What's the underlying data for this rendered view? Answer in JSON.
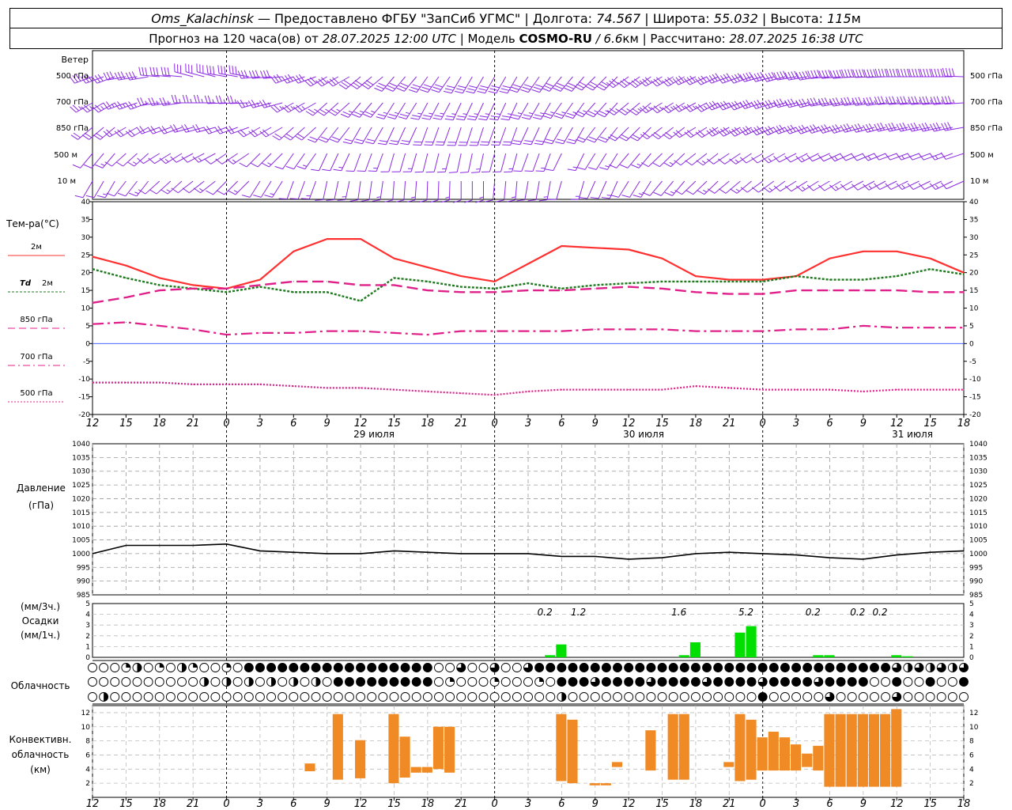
{
  "header": {
    "station": "Oms_Kalachinsk",
    "provider": "— Предоставлено ФГБУ \"ЗапСиб УГМС\"",
    "lon_label": "| Долгота:",
    "lon_value": "74.567",
    "lat_label": "| Широта:",
    "lat_value": "55.032",
    "alt_label": "| Высота:",
    "alt_value": "115",
    "alt_unit": "м",
    "forecast_label": "Прогноз на 120 часа(ов) от",
    "forecast_time": "28.07.2025 12:00 UTC",
    "model_label": "| Модель",
    "model_name": "COSMO-RU",
    "model_res": "/ 6.6",
    "model_res_unit": "км",
    "calc_label": "| Рассчитано:",
    "calc_time": "28.07.2025 16:38 UTC"
  },
  "wind_panel": {
    "title": "Ветер",
    "levels": [
      "500 гПа",
      "700 гПа",
      "850 гПа",
      "500 м",
      "10 м"
    ],
    "barb_color": "#8a2be2"
  },
  "temperature_panel": {
    "title": "Тем-ра(°С)",
    "legend": [
      {
        "label": "2м",
        "color": "#ff3030",
        "style": "solid"
      },
      {
        "label": "Td",
        "label2": "2м",
        "color": "#1f7a1f",
        "style": "dotted"
      },
      {
        "label": "850 гПа",
        "color": "#e0208a",
        "style": "dashed"
      },
      {
        "label": "700 гПа",
        "color": "#e0208a",
        "style": "dashdot"
      },
      {
        "label": "500 гПа",
        "color": "#e0208a",
        "style": "dotted"
      }
    ]
  },
  "time_axis": {
    "hour_labels": [
      "12",
      "15",
      "18",
      "21",
      "0",
      "3",
      "6",
      "9",
      "12",
      "15",
      "18",
      "21",
      "0",
      "3",
      "6",
      "9",
      "12",
      "15",
      "18",
      "21",
      "0",
      "3",
      "6",
      "9",
      "12",
      "15",
      "18"
    ],
    "day_labels": [
      "29 июля",
      "30 июля",
      "31 июля"
    ]
  },
  "pressure_panel": {
    "title_line1": "Давление",
    "title_line2": "(гПа)",
    "color": "#000000"
  },
  "precip_panel": {
    "title_line1": "(мм/3ч.)",
    "title_line2": "Осадки",
    "title_line3": "(мм/1ч.)",
    "color": "#00e000",
    "labels": [
      "0.2",
      "1.2",
      "1.6",
      "5.2",
      "0.2",
      "0.2",
      "0.2"
    ]
  },
  "cloud_panel": {
    "title": "Облачность"
  },
  "convective_panel": {
    "title_line1": "Конвективн.",
    "title_line2": "облачность",
    "title_line3": "(км)",
    "color": "#f08a24"
  },
  "chart_data": [
    {
      "type": "line",
      "title": "Тем-ра(°С)",
      "x_hours": [
        0,
        3,
        6,
        9,
        12,
        15,
        18,
        21,
        24,
        27,
        30,
        33,
        36,
        39,
        42,
        45,
        48,
        51,
        54,
        57,
        60,
        63,
        66,
        69,
        72,
        75,
        78
      ],
      "ylim": [
        -20,
        40
      ],
      "yticks": [
        -20,
        -15,
        -10,
        -5,
        0,
        5,
        10,
        15,
        20,
        25,
        30,
        35,
        40
      ],
      "series": [
        {
          "name": "2м",
          "values": [
            24.5,
            22,
            18.5,
            16.5,
            15.5,
            18,
            26,
            29.5,
            29.5,
            24,
            21.5,
            19,
            17.5,
            22.5,
            27.5,
            27,
            26.5,
            24,
            19,
            18,
            18,
            19,
            24,
            26,
            26,
            24,
            20
          ]
        },
        {
          "name": "Td 2м",
          "values": [
            21,
            18.5,
            16.5,
            15.5,
            14.5,
            16,
            14.5,
            14.5,
            12,
            18.5,
            17.5,
            16,
            15.5,
            17,
            15.5,
            16.5,
            17,
            17.5,
            17.5,
            17.5,
            17.5,
            19,
            18,
            18,
            19,
            21,
            19.5
          ]
        },
        {
          "name": "850 гПа",
          "values": [
            11.5,
            13,
            15,
            15.5,
            15.5,
            16.5,
            17.5,
            17.5,
            16.5,
            16.5,
            15,
            14.5,
            14.5,
            15,
            15,
            15.5,
            16,
            15.5,
            14.5,
            14,
            14,
            15,
            15,
            15,
            15,
            14.5,
            14.5
          ]
        },
        {
          "name": "700 гПа",
          "values": [
            5.5,
            6,
            5,
            4,
            2.5,
            3,
            3,
            3.5,
            3.5,
            3,
            2.5,
            3.5,
            3.5,
            3.5,
            3.5,
            4,
            4,
            4,
            3.5,
            3.5,
            3.5,
            4,
            4,
            5,
            4.5,
            4.5,
            4.5
          ]
        },
        {
          "name": "500 гПа",
          "values": [
            -11,
            -11,
            -11,
            -11.5,
            -11.5,
            -11.5,
            -12,
            -12.5,
            -12.5,
            -13,
            -13.5,
            -14,
            -14.5,
            -13.5,
            -13,
            -13,
            -13,
            -13,
            -12,
            -12.5,
            -13,
            -13,
            -13,
            -13.5,
            -13,
            -13,
            -13
          ]
        }
      ]
    },
    {
      "type": "line",
      "title": "Давление",
      "x_hours": [
        0,
        3,
        6,
        9,
        12,
        15,
        18,
        21,
        24,
        27,
        30,
        33,
        36,
        39,
        42,
        45,
        48,
        51,
        54,
        57,
        60,
        63,
        66,
        69,
        72,
        75,
        78
      ],
      "ylim": [
        985,
        1040
      ],
      "yticks": [
        985,
        990,
        995,
        1000,
        1005,
        1010,
        1015,
        1020,
        1025,
        1030,
        1035,
        1040
      ],
      "series": [
        {
          "name": "Давление",
          "values": [
            1000,
            1003,
            1003,
            1003,
            1003.5,
            1001,
            1000.5,
            1000,
            1000,
            1001,
            1000.5,
            1000,
            1000,
            1000,
            999,
            999,
            998,
            998.5,
            1000,
            1000.5,
            1000,
            999.5,
            998.5,
            998,
            999.5,
            1000.5,
            1001
          ]
        }
      ]
    },
    {
      "type": "bar",
      "title": "Осадки",
      "ylim": [
        0,
        5
      ],
      "yticks": [
        0,
        1,
        2,
        3,
        4,
        5
      ],
      "x_hours": [
        41,
        42,
        53,
        54,
        58,
        59,
        65,
        66,
        72,
        73
      ],
      "values": [
        0.2,
        1.2,
        0.2,
        1.4,
        2.3,
        2.9,
        0.2,
        0.2,
        0.2,
        0.1
      ],
      "labels": [
        {
          "text": "0.2",
          "hour": 40.5
        },
        {
          "text": "1.2",
          "hour": 43.5
        },
        {
          "text": "1.6",
          "hour": 52.5
        },
        {
          "text": "5.2",
          "hour": 58.5
        },
        {
          "text": "0.2",
          "hour": 64.5
        },
        {
          "text": "0.2",
          "hour": 68.5
        },
        {
          "text": "0.2",
          "hour": 70.5
        }
      ]
    },
    {
      "type": "bar",
      "title": "Конвективн. облачность",
      "ylim": [
        0,
        13
      ],
      "yticks": [
        0,
        2,
        4,
        6,
        8,
        10,
        12
      ],
      "bars": [
        {
          "hour": 19.5,
          "base": 3.7,
          "top": 4.8
        },
        {
          "hour": 22,
          "base": 2.5,
          "top": 11.8
        },
        {
          "hour": 24,
          "base": 2.7,
          "top": 8.1
        },
        {
          "hour": 27,
          "base": 2.0,
          "top": 11.8
        },
        {
          "hour": 28,
          "base": 2.8,
          "top": 8.6
        },
        {
          "hour": 29,
          "base": 3.5,
          "top": 4.3
        },
        {
          "hour": 30,
          "base": 3.5,
          "top": 4.3
        },
        {
          "hour": 31,
          "base": 4.0,
          "top": 10.0
        },
        {
          "hour": 32,
          "base": 3.5,
          "top": 10.0
        },
        {
          "hour": 42,
          "base": 2.3,
          "top": 11.8
        },
        {
          "hour": 43,
          "base": 2.0,
          "top": 11.0
        },
        {
          "hour": 45,
          "base": 1.7,
          "top": 2.0
        },
        {
          "hour": 46,
          "base": 1.7,
          "top": 2.0
        },
        {
          "hour": 47,
          "base": 4.3,
          "top": 5.0
        },
        {
          "hour": 50,
          "base": 3.8,
          "top": 9.5
        },
        {
          "hour": 52,
          "base": 2.5,
          "top": 11.8
        },
        {
          "hour": 53,
          "base": 2.5,
          "top": 11.8
        },
        {
          "hour": 57,
          "base": 4.3,
          "top": 5.0
        },
        {
          "hour": 58,
          "base": 2.3,
          "top": 11.8
        },
        {
          "hour": 59,
          "base": 2.5,
          "top": 11.0
        },
        {
          "hour": 60,
          "base": 3.8,
          "top": 8.5
        },
        {
          "hour": 61,
          "base": 3.8,
          "top": 9.3
        },
        {
          "hour": 62,
          "base": 3.8,
          "top": 8.5
        },
        {
          "hour": 63,
          "base": 3.8,
          "top": 7.5
        },
        {
          "hour": 64,
          "base": 4.3,
          "top": 6.2
        },
        {
          "hour": 65,
          "base": 3.8,
          "top": 7.3
        },
        {
          "hour": 66,
          "base": 1.5,
          "top": 11.8
        },
        {
          "hour": 67,
          "base": 1.5,
          "top": 11.8
        },
        {
          "hour": 68,
          "base": 1.5,
          "top": 11.8
        },
        {
          "hour": 69,
          "base": 1.5,
          "top": 11.8
        },
        {
          "hour": 70,
          "base": 1.5,
          "top": 11.8
        },
        {
          "hour": 71,
          "base": 1.5,
          "top": 11.8
        },
        {
          "hour": 72,
          "base": 1.5,
          "top": 12.5
        }
      ]
    }
  ]
}
